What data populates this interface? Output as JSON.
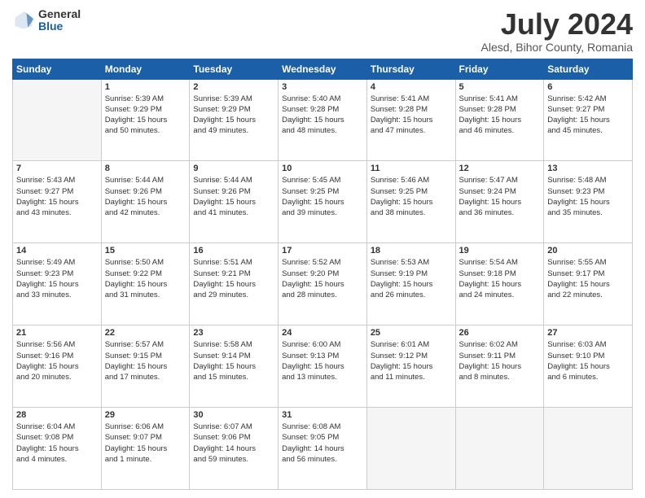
{
  "logo": {
    "general": "General",
    "blue": "Blue"
  },
  "title": "July 2024",
  "subtitle": "Alesd, Bihor County, Romania",
  "weekdays": [
    "Sunday",
    "Monday",
    "Tuesday",
    "Wednesday",
    "Thursday",
    "Friday",
    "Saturday"
  ],
  "weeks": [
    [
      {
        "day": "",
        "empty": true
      },
      {
        "day": "1",
        "sunrise": "5:39 AM",
        "sunset": "9:29 PM",
        "daylight": "15 hours and 50 minutes."
      },
      {
        "day": "2",
        "sunrise": "5:39 AM",
        "sunset": "9:29 PM",
        "daylight": "15 hours and 49 minutes."
      },
      {
        "day": "3",
        "sunrise": "5:40 AM",
        "sunset": "9:28 PM",
        "daylight": "15 hours and 48 minutes."
      },
      {
        "day": "4",
        "sunrise": "5:41 AM",
        "sunset": "9:28 PM",
        "daylight": "15 hours and 47 minutes."
      },
      {
        "day": "5",
        "sunrise": "5:41 AM",
        "sunset": "9:28 PM",
        "daylight": "15 hours and 46 minutes."
      },
      {
        "day": "6",
        "sunrise": "5:42 AM",
        "sunset": "9:27 PM",
        "daylight": "15 hours and 45 minutes."
      }
    ],
    [
      {
        "day": "7",
        "sunrise": "5:43 AM",
        "sunset": "9:27 PM",
        "daylight": "15 hours and 43 minutes."
      },
      {
        "day": "8",
        "sunrise": "5:44 AM",
        "sunset": "9:26 PM",
        "daylight": "15 hours and 42 minutes."
      },
      {
        "day": "9",
        "sunrise": "5:44 AM",
        "sunset": "9:26 PM",
        "daylight": "15 hours and 41 minutes."
      },
      {
        "day": "10",
        "sunrise": "5:45 AM",
        "sunset": "9:25 PM",
        "daylight": "15 hours and 39 minutes."
      },
      {
        "day": "11",
        "sunrise": "5:46 AM",
        "sunset": "9:25 PM",
        "daylight": "15 hours and 38 minutes."
      },
      {
        "day": "12",
        "sunrise": "5:47 AM",
        "sunset": "9:24 PM",
        "daylight": "15 hours and 36 minutes."
      },
      {
        "day": "13",
        "sunrise": "5:48 AM",
        "sunset": "9:23 PM",
        "daylight": "15 hours and 35 minutes."
      }
    ],
    [
      {
        "day": "14",
        "sunrise": "5:49 AM",
        "sunset": "9:23 PM",
        "daylight": "15 hours and 33 minutes."
      },
      {
        "day": "15",
        "sunrise": "5:50 AM",
        "sunset": "9:22 PM",
        "daylight": "15 hours and 31 minutes."
      },
      {
        "day": "16",
        "sunrise": "5:51 AM",
        "sunset": "9:21 PM",
        "daylight": "15 hours and 29 minutes."
      },
      {
        "day": "17",
        "sunrise": "5:52 AM",
        "sunset": "9:20 PM",
        "daylight": "15 hours and 28 minutes."
      },
      {
        "day": "18",
        "sunrise": "5:53 AM",
        "sunset": "9:19 PM",
        "daylight": "15 hours and 26 minutes."
      },
      {
        "day": "19",
        "sunrise": "5:54 AM",
        "sunset": "9:18 PM",
        "daylight": "15 hours and 24 minutes."
      },
      {
        "day": "20",
        "sunrise": "5:55 AM",
        "sunset": "9:17 PM",
        "daylight": "15 hours and 22 minutes."
      }
    ],
    [
      {
        "day": "21",
        "sunrise": "5:56 AM",
        "sunset": "9:16 PM",
        "daylight": "15 hours and 20 minutes."
      },
      {
        "day": "22",
        "sunrise": "5:57 AM",
        "sunset": "9:15 PM",
        "daylight": "15 hours and 17 minutes."
      },
      {
        "day": "23",
        "sunrise": "5:58 AM",
        "sunset": "9:14 PM",
        "daylight": "15 hours and 15 minutes."
      },
      {
        "day": "24",
        "sunrise": "6:00 AM",
        "sunset": "9:13 PM",
        "daylight": "15 hours and 13 minutes."
      },
      {
        "day": "25",
        "sunrise": "6:01 AM",
        "sunset": "9:12 PM",
        "daylight": "15 hours and 11 minutes."
      },
      {
        "day": "26",
        "sunrise": "6:02 AM",
        "sunset": "9:11 PM",
        "daylight": "15 hours and 8 minutes."
      },
      {
        "day": "27",
        "sunrise": "6:03 AM",
        "sunset": "9:10 PM",
        "daylight": "15 hours and 6 minutes."
      }
    ],
    [
      {
        "day": "28",
        "sunrise": "6:04 AM",
        "sunset": "9:08 PM",
        "daylight": "15 hours and 4 minutes."
      },
      {
        "day": "29",
        "sunrise": "6:06 AM",
        "sunset": "9:07 PM",
        "daylight": "15 hours and 1 minute."
      },
      {
        "day": "30",
        "sunrise": "6:07 AM",
        "sunset": "9:06 PM",
        "daylight": "14 hours and 59 minutes."
      },
      {
        "day": "31",
        "sunrise": "6:08 AM",
        "sunset": "9:05 PM",
        "daylight": "14 hours and 56 minutes."
      },
      {
        "day": "",
        "empty": true
      },
      {
        "day": "",
        "empty": true
      },
      {
        "day": "",
        "empty": true
      }
    ]
  ]
}
